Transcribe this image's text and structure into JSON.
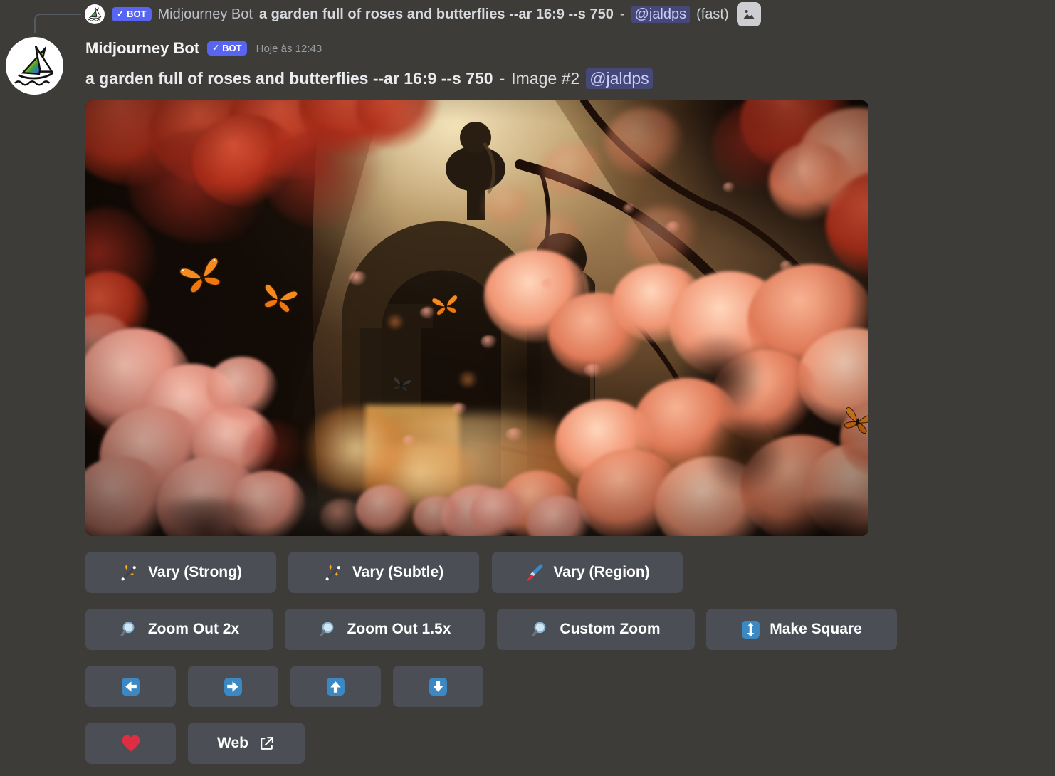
{
  "reply_bar": {
    "bot_badge": "BOT",
    "check": "✓",
    "username": "Midjourney Bot",
    "preview_prompt": "a garden full of roses and butterflies --ar 16:9 --s 750",
    "separator": "-",
    "mention": "@jaldps",
    "mode": "(fast)"
  },
  "message": {
    "username": "Midjourney Bot",
    "bot_badge": "BOT",
    "check": "✓",
    "timestamp": "Hoje às 12:43",
    "prompt": "a garden full of roses and butterflies --ar 16:9 --s 750",
    "separator": "-",
    "image_label": "Image #2",
    "mention": "@jaldps",
    "image_description": "AI-generated garden full of roses and butterflies: warm golden light over dark stone ruins, coral-pink rose clusters and orange monarch butterflies"
  },
  "buttons": {
    "vary_strong": "Vary (Strong)",
    "vary_subtle": "Vary (Subtle)",
    "vary_region": "Vary (Region)",
    "zoom_out_2x": "Zoom Out 2x",
    "zoom_out_1_5x": "Zoom Out 1.5x",
    "custom_zoom": "Custom Zoom",
    "make_square": "Make Square",
    "web": "Web"
  },
  "colors": {
    "background": "#3d3c38",
    "blurple": "#5865f2",
    "button_bg": "#4b4e55",
    "arrow_blue": "#3b88c3",
    "heart_red": "#dd2e44",
    "mention_text": "#c9cdfb"
  }
}
